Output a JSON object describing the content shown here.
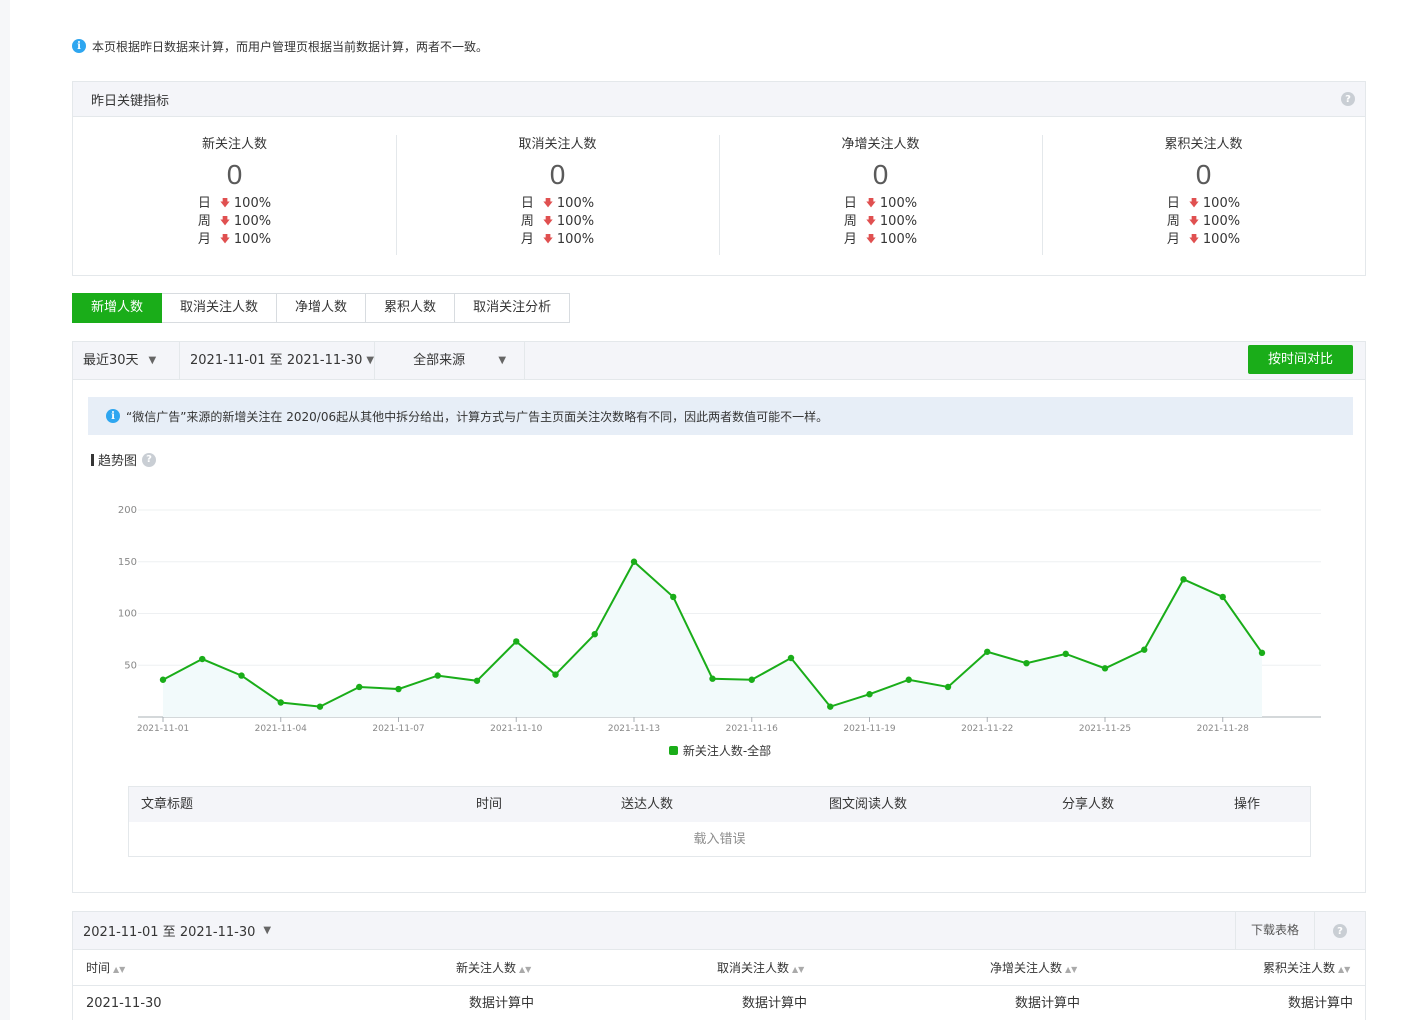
{
  "notice": {
    "icon": "info-icon",
    "text": "本页根据昨日数据来计算，而用户管理页根据当前数据计算，两者不一致。"
  },
  "kpi_panel": {
    "title": "昨日关键指标",
    "metrics": [
      {
        "label": "新关注人数",
        "value": "0",
        "changes": [
          {
            "period": "日",
            "pct": "100%"
          },
          {
            "period": "周",
            "pct": "100%"
          },
          {
            "period": "月",
            "pct": "100%"
          }
        ]
      },
      {
        "label": "取消关注人数",
        "value": "0",
        "changes": [
          {
            "period": "日",
            "pct": "100%"
          },
          {
            "period": "周",
            "pct": "100%"
          },
          {
            "period": "月",
            "pct": "100%"
          }
        ]
      },
      {
        "label": "净增关注人数",
        "value": "0",
        "changes": [
          {
            "period": "日",
            "pct": "100%"
          },
          {
            "period": "周",
            "pct": "100%"
          },
          {
            "period": "月",
            "pct": "100%"
          }
        ]
      },
      {
        "label": "累积关注人数",
        "value": "0",
        "changes": [
          {
            "period": "日",
            "pct": "100%"
          },
          {
            "period": "周",
            "pct": "100%"
          },
          {
            "period": "月",
            "pct": "100%"
          }
        ]
      }
    ]
  },
  "tabs": [
    {
      "label": "新增人数",
      "active": true
    },
    {
      "label": "取消关注人数",
      "active": false
    },
    {
      "label": "净增人数",
      "active": false
    },
    {
      "label": "累积人数",
      "active": false
    },
    {
      "label": "取消关注分析",
      "active": false
    }
  ],
  "filters": {
    "period": "最近30天",
    "range": "2021-11-01 至 2021-11-30",
    "source": "全部来源",
    "compare_button": "按时间对比"
  },
  "chart_tip": "“微信广告”来源的新增关注在 2020/06起从其他中拆分给出，计算方式与广告主页面关注次数略有不同，因此两者数值可能不一样。",
  "trend_title": "趋势图",
  "colors": {
    "accent": "#1aad19",
    "line": "#1aad19",
    "down": "#e05050"
  },
  "chart_data": {
    "type": "line",
    "x": [
      "2021-11-01",
      "2021-11-02",
      "2021-11-03",
      "2021-11-04",
      "2021-11-05",
      "2021-11-06",
      "2021-11-07",
      "2021-11-08",
      "2021-11-09",
      "2021-11-10",
      "2021-11-11",
      "2021-11-12",
      "2021-11-13",
      "2021-11-14",
      "2021-11-15",
      "2021-11-16",
      "2021-11-17",
      "2021-11-18",
      "2021-11-19",
      "2021-11-20",
      "2021-11-21",
      "2021-11-22",
      "2021-11-23",
      "2021-11-24",
      "2021-11-25",
      "2021-11-26",
      "2021-11-27",
      "2021-11-28",
      "2021-11-29"
    ],
    "x_tick_labels": [
      "2021-11-01",
      "2021-11-04",
      "2021-11-07",
      "2021-11-10",
      "2021-11-13",
      "2021-11-16",
      "2021-11-19",
      "2021-11-22",
      "2021-11-25",
      "2021-11-28"
    ],
    "series": [
      {
        "name": "新关注人数-全部",
        "values": [
          36,
          56,
          40,
          14,
          10,
          29,
          27,
          40,
          35,
          73,
          41,
          80,
          150,
          116,
          37,
          36,
          57,
          10,
          22,
          36,
          29,
          63,
          52,
          61,
          47,
          65,
          133,
          116,
          62
        ]
      }
    ],
    "y_ticks": [
      50,
      100,
      150,
      200
    ],
    "ylim": [
      0,
      200
    ],
    "grid": true,
    "legend": "bottom-center"
  },
  "article_table": {
    "columns": [
      "文章标题",
      "时间",
      "送达人数",
      "图文阅读人数",
      "分享人数",
      "操作"
    ],
    "empty_text": "载入错误"
  },
  "data_table": {
    "range": "2021-11-01 至 2021-11-30",
    "download": "下载表格",
    "columns": [
      "时间",
      "新关注人数",
      "取消关注人数",
      "净增关注人数",
      "累积关注人数"
    ],
    "rows": [
      [
        "2021-11-30",
        "数据计算中",
        "数据计算中",
        "数据计算中",
        "数据计算中"
      ]
    ]
  }
}
